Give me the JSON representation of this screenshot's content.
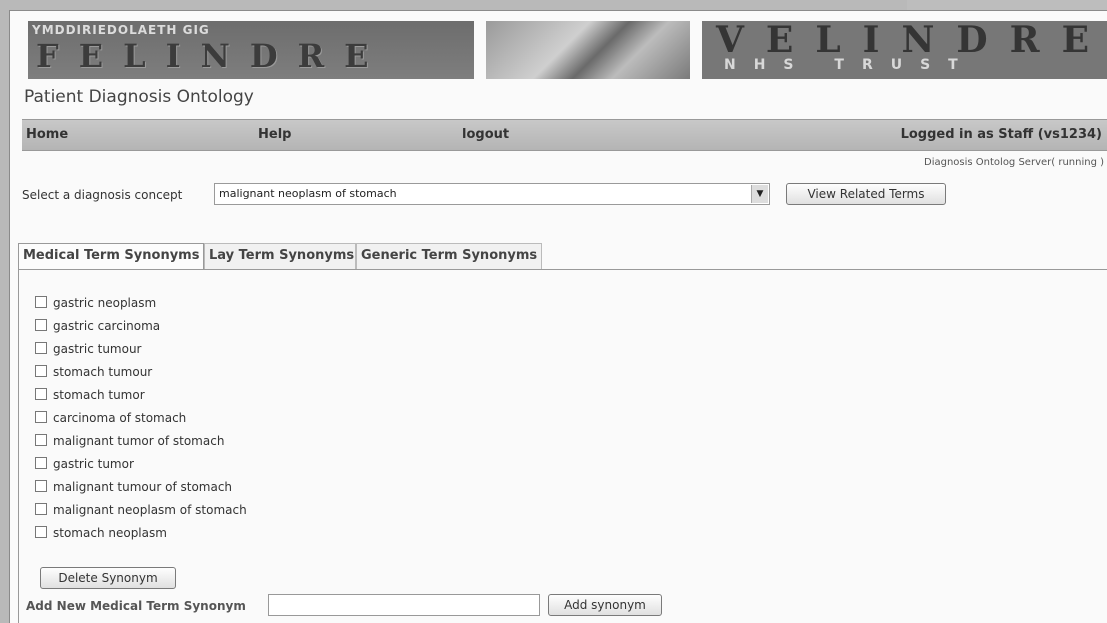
{
  "banner": {
    "welsh_text": "YMDDIRIEDOLAETH GIG",
    "left_brand": "FELINDRE",
    "right_brand": "VELINDRE",
    "right_sub": "NHS TRUST"
  },
  "app_title": "Patient Diagnosis Ontology",
  "nav": {
    "home": "Home",
    "help": "Help",
    "logout": "logout",
    "login_status": "Logged in as Staff (vs1234)"
  },
  "server_status": "Diagnosis Ontolog Server( running )",
  "concept": {
    "label": "Select a diagnosis concept",
    "selected": "malignant neoplasm of stomach",
    "button": "View Related Terms"
  },
  "tabs": [
    {
      "label": "Medical Term Synonyms",
      "active": true
    },
    {
      "label": "Lay Term Synonyms",
      "active": false
    },
    {
      "label": "Generic Term Synonyms",
      "active": false
    }
  ],
  "synonyms": [
    "gastric neoplasm",
    "gastric carcinoma",
    "gastric tumour",
    "stomach tumour",
    "stomach tumor",
    "carcinoma of stomach",
    "malignant tumor of stomach",
    "gastric tumor",
    "malignant tumour of stomach",
    "malignant neoplasm of stomach",
    "stomach neoplasm"
  ],
  "actions": {
    "delete": "Delete Synonym",
    "add_label": "Add New Medical Term Synonym",
    "add_button": "Add synonym",
    "add_value": ""
  }
}
